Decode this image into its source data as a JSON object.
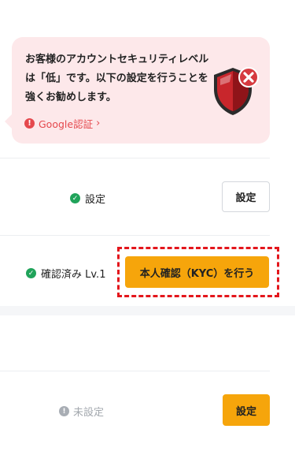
{
  "alert": {
    "message": "お客様のアカウントセキュリティレベルは「低」です。以下の設定を行うことを強くお勧めします。",
    "link_label": "Google認証",
    "link_chevron": "›",
    "warn_symbol": "!",
    "icon": "shield-warning-icon"
  },
  "rows": {
    "google_auth": {
      "status": "設定",
      "status_icon": "check-circle-icon",
      "button": "設定"
    },
    "identity": {
      "status": "確認済み Lv.1",
      "status_icon": "check-circle-icon",
      "button": "本人確認（KYC）を行う"
    },
    "other": {
      "status": "未設定",
      "status_icon": "info-circle-icon",
      "button": "設定"
    }
  },
  "symbols": {
    "check": "✓",
    "info": "!"
  },
  "colors": {
    "alert_bg": "#fde8ea",
    "danger": "#e5484d",
    "success": "#20a35a",
    "primary": "#f6a50b",
    "highlight": "#e3161c"
  }
}
